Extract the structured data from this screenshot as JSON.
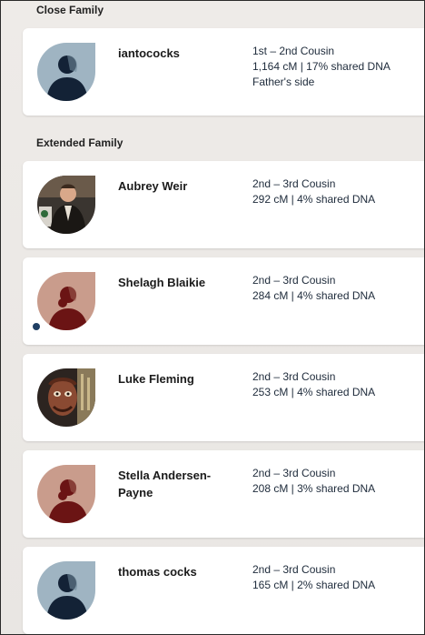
{
  "sections": {
    "close": {
      "title": "Close Family"
    },
    "extended": {
      "title": "Extended Family"
    }
  },
  "matches": [
    {
      "name": "iantococks",
      "relationship": "1st – 2nd Cousin",
      "dna": "1,164 cM | 17% shared DNA",
      "side": "Father's side",
      "avatar": "male-silhouette-blue"
    },
    {
      "name": "Aubrey Weir",
      "relationship": "2nd – 3rd Cousin",
      "dna": "292 cM | 4% shared DNA",
      "avatar": "photo-man-dark-jacket"
    },
    {
      "name": "Shelagh Blaikie",
      "relationship": "2nd – 3rd Cousin",
      "dna": "284 cM | 4% shared DNA",
      "avatar": "female-silhouette-red",
      "unviewed_indicator": true
    },
    {
      "name": "Luke Fleming",
      "relationship": "2nd – 3rd Cousin",
      "dna": "253 cM | 4% shared DNA",
      "avatar": "photo-face-costume"
    },
    {
      "name": "Stella Andersen-Payne",
      "relationship": "2nd – 3rd Cousin",
      "dna": "208 cM | 3% shared DNA",
      "avatar": "female-silhouette-red"
    },
    {
      "name": "thomas cocks",
      "relationship": "2nd – 3rd Cousin",
      "dna": "165 cM | 2% shared DNA",
      "avatar": "male-silhouette-blue"
    }
  ],
  "colors": {
    "male_bg": "#9fb4c2",
    "male_fg": "#132236",
    "female_bg": "#c99c8c",
    "female_fg": "#6b1414",
    "indicator": "#1f3f63"
  }
}
